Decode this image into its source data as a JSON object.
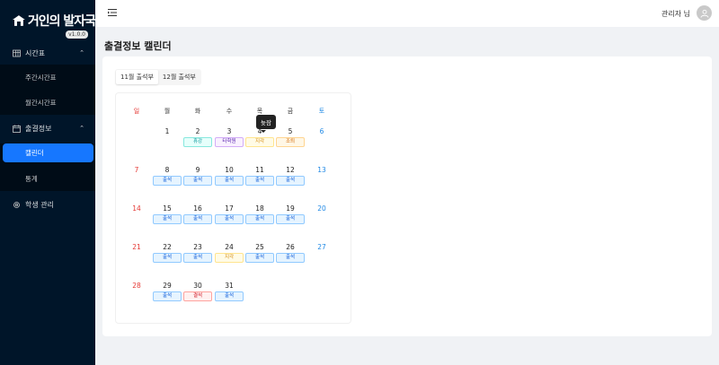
{
  "app": {
    "logo_text": "거인의 발자국",
    "version": "v1.0.0"
  },
  "sidebar": {
    "groups": [
      {
        "label": "시간표",
        "items": [
          "주간시간표",
          "월간시간표"
        ]
      },
      {
        "label": "출결정보",
        "items": [
          "캘린더",
          "통계"
        ]
      },
      {
        "label": "학생 관리",
        "items": []
      }
    ]
  },
  "header": {
    "user": "관리자 님"
  },
  "page": {
    "title": "출결정보 캘린더"
  },
  "tabs": [
    "11월 출석부",
    "12월 출석부"
  ],
  "calendar": {
    "weekdays": [
      "일",
      "월",
      "화",
      "수",
      "목",
      "금",
      "토"
    ],
    "days": [
      "1",
      "2",
      "3",
      "4",
      "5",
      "6",
      "7",
      "8",
      "9",
      "10",
      "11",
      "12",
      "13",
      "14",
      "15",
      "16",
      "17",
      "18",
      "19",
      "20",
      "21",
      "22",
      "23",
      "24",
      "25",
      "26",
      "27",
      "28",
      "29",
      "30",
      "31"
    ],
    "badges": {
      "2": "휴강",
      "3": "타학원",
      "4": "지각",
      "5": "조퇴",
      "8": "출석",
      "9": "출석",
      "10": "출석",
      "11": "출석",
      "12": "출석",
      "15": "출석",
      "16": "출석",
      "17": "출석",
      "18": "출석",
      "19": "출석",
      "22": "출석",
      "23": "출석",
      "24": "지각",
      "25": "출석",
      "26": "출석",
      "29": "출석",
      "30": "결석",
      "31": "출석"
    },
    "tooltip": "늦잠"
  },
  "colors": {
    "sidebar_bg": "#001529",
    "accent": "#1677ff"
  }
}
